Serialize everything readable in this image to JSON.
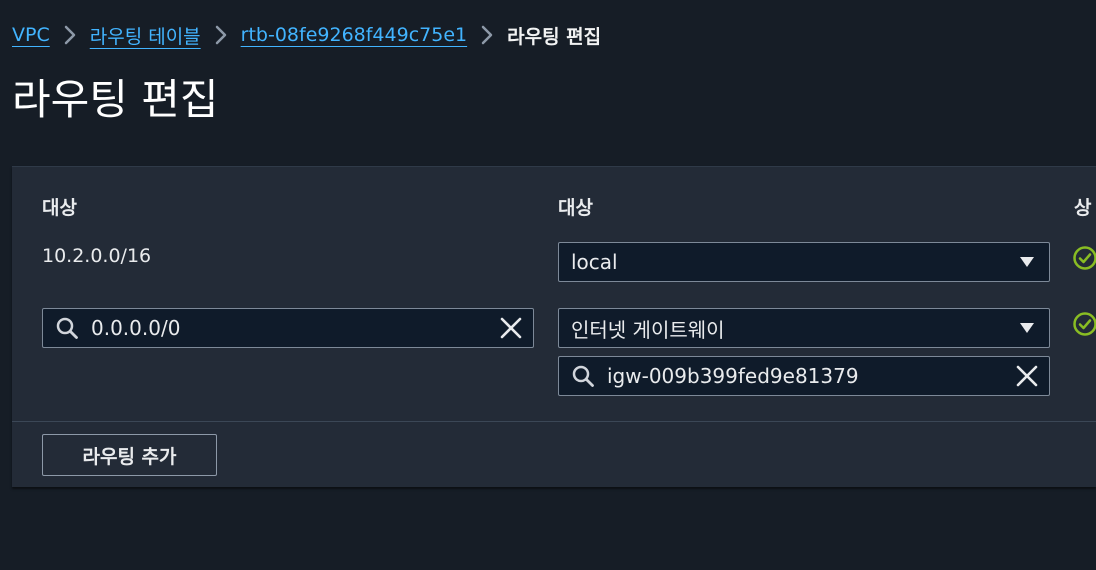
{
  "breadcrumb": {
    "items": [
      {
        "label": "VPC"
      },
      {
        "label": "라우팅 테이블"
      },
      {
        "label": "rtb-08fe9268f449c75e1"
      }
    ],
    "current": "라우팅 편집"
  },
  "page": {
    "title": "라우팅 편집"
  },
  "routes": {
    "columns": {
      "destination": "대상",
      "target": "대상",
      "status": "상"
    },
    "rows": [
      {
        "destination": "10.2.0.0/16",
        "target_type": "local",
        "status": "active"
      },
      {
        "destination": "0.0.0.0/0",
        "target_type": "인터넷 게이트웨이",
        "target_id": "igw-009b399fed9e81379",
        "status": "active"
      }
    ],
    "add_button": "라우팅 추가"
  },
  "colors": {
    "background": "#161d26",
    "panel": "#232b37",
    "link": "#42b4ff",
    "success": "#89bd23",
    "input_bg": "#0f1b2a",
    "border": "#7d8998"
  },
  "icons": {
    "breadcrumb_separator": "chevron-right-icon",
    "dropdown": "caret-down-icon",
    "search": "search-icon",
    "clear": "close-icon",
    "status": "check-circle-icon"
  }
}
